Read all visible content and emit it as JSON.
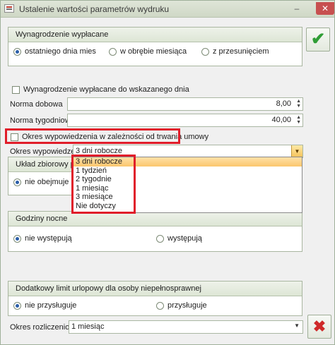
{
  "window": {
    "title": "Ustalenie wartości parametrów wydruku",
    "minimize": "–",
    "close": "✕"
  },
  "wynagrodzenie": {
    "header": "Wynagrodzenie wypłacane",
    "options": [
      "ostatniego dnia mies",
      "w obrębie miesiąca",
      "z przesunięciem"
    ],
    "selected": 0
  },
  "wskazany_dzien": {
    "label": "Wynagrodzenie wypłacane do wskazanego dnia",
    "checked": false
  },
  "norma_dobowa": {
    "label": "Norma dobowa",
    "value": "8,00"
  },
  "norma_tygodniowa": {
    "label": "Norma tygodniowa",
    "value": "40,00"
  },
  "okres_zaleznosc": {
    "label": "Okres wypowiedzenia w zależności od trwania umowy",
    "checked": false
  },
  "okres_wypowiedzenia": {
    "label": "Okres wypowiedzenia",
    "value": "3 dni robocze",
    "options": [
      "3 dni robocze",
      "1 tydzień",
      "2 tygodnie",
      "1 miesiąc",
      "3 miesiące",
      "Nie dotyczy"
    ],
    "highlighted": 0
  },
  "uklad_zbiorowy": {
    "header": "Układ zbiorowy pra",
    "options": [
      "nie obejmuje"
    ],
    "selected": 0
  },
  "godziny_nocne": {
    "header": "Godziny nocne",
    "options": [
      "nie występują",
      "występują"
    ],
    "selected": 0
  },
  "limit_urlopowy": {
    "header": "Dodatkowy limit urlopowy dla osoby niepełnosprawnej",
    "options": [
      "nie przysługuje",
      "przysługuje"
    ],
    "selected": 0
  },
  "okres_rozliczeniowy": {
    "label": "Okres rozliczeniowy",
    "value": "1 miesiąc"
  },
  "buttons": {
    "ok": "✔",
    "cancel": "✖"
  },
  "colors": {
    "highlight": "#e01d2a",
    "ok": "#2f9d35",
    "cancel": "#cf2a2a",
    "dropdown_selected": "#fbc66d"
  },
  "icons": [
    "app-icon",
    "checkmark-icon",
    "cross-icon",
    "spinner-arrows-icon",
    "dropdown-arrow-icon"
  ]
}
